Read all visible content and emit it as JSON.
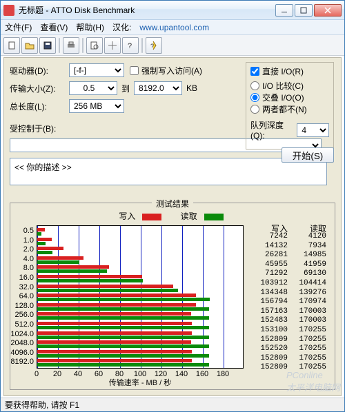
{
  "window": {
    "title": "无标题 - ATTO Disk Benchmark"
  },
  "menu": {
    "file": "文件(F)",
    "view": "查看(V)",
    "help": "帮助(H)",
    "chs": "汉化:",
    "url": "www.upantool.com"
  },
  "controls": {
    "drive_label": "驱动器(D):",
    "drive_value": "[-f-]",
    "xfer_label": "传输大小(Z):",
    "xfer_from": "0.5",
    "to_label": "到",
    "xfer_to": "8192.0",
    "kb": "KB",
    "length_label": "总长度(L):",
    "length_value": "256 MB",
    "force_write": "强制写入访问(A)",
    "direct_io": "直接 I/O(R)",
    "radio_compare": "I/O 比较(C)",
    "radio_overlap": "交叠 I/O(O)",
    "radio_neither": "两者都不(N)",
    "queue_label": "队列深度(Q):",
    "queue_value": "4",
    "controlled_label": "受控制于(B):",
    "start": "开始(S)"
  },
  "desc": {
    "text": "<<   你的描述     >>"
  },
  "results": {
    "title": "测试结果",
    "legend_write": "写入",
    "legend_read": "读取",
    "xlabel": "传输速率 - MB / 秒",
    "col_write": "写入",
    "col_read": "读取",
    "max_mb": 200,
    "xticks": [
      0,
      20,
      40,
      60,
      80,
      100,
      120,
      140,
      160,
      180
    ],
    "sizes": [
      "0.5",
      "1.0",
      "2.0",
      "4.0",
      "8.0",
      "16.0",
      "32.0",
      "64.0",
      "128.0",
      "256.0",
      "512.0",
      "1024.0",
      "2048.0",
      "4096.0",
      "8192.0"
    ]
  },
  "chart_data": {
    "type": "bar",
    "title": "测试结果",
    "xlabel": "传输速率 - MB / 秒",
    "ylabel": "",
    "xlim": [
      0,
      200
    ],
    "categories": [
      "0.5",
      "1.0",
      "2.0",
      "4.0",
      "8.0",
      "16.0",
      "32.0",
      "64.0",
      "128.0",
      "256.0",
      "512.0",
      "1024.0",
      "2048.0",
      "4096.0",
      "8192.0"
    ],
    "series": [
      {
        "name": "写入",
        "unit": "KB/s",
        "values": [
          7242,
          14132,
          26281,
          45955,
          71292,
          103912,
          134348,
          156794,
          157163,
          152483,
          153100,
          152809,
          152520,
          152809,
          152809
        ]
      },
      {
        "name": "读取",
        "unit": "KB/s",
        "values": [
          4120,
          7934,
          14985,
          41959,
          69130,
          104414,
          139276,
          170974,
          170003,
          170003,
          170255,
          170255,
          170255,
          170255,
          170255
        ]
      }
    ]
  },
  "status": {
    "text": "要获得帮助, 请按 F1"
  },
  "watermark": {
    "line1": "PConline",
    "line2": "太平洋电脑网"
  }
}
